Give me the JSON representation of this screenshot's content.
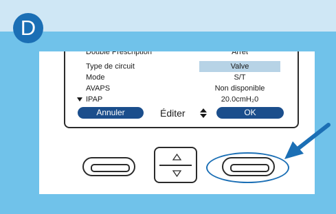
{
  "step": {
    "letter": "D"
  },
  "screen": {
    "partial_row": {
      "label": "Double Prescription",
      "value": "Arrêt"
    },
    "rows": [
      {
        "label": "Type de circuit",
        "value": "Valve",
        "selected": true
      },
      {
        "label": "Mode",
        "value": "S/T"
      },
      {
        "label": "AVAPS",
        "value": "Non disponible"
      },
      {
        "label": "IPAP",
        "value": "20.0cmH₂0"
      }
    ],
    "softkeys": {
      "left": "Annuler",
      "center": "Éditer",
      "right": "OK"
    }
  },
  "hardware": {
    "nav_icons": [
      "up-triangle-icon",
      "down-triangle-icon"
    ],
    "selector_icon": "up-down-arrow-icon",
    "scroll_marker_icon": "down-triangle-icon"
  },
  "colors": {
    "top_bar": "#cfe7f5",
    "frame": "#70c2ea",
    "badge": "#1b6fb5",
    "softkey": "#1b4e8c",
    "selection": "#b7d3e6",
    "highlight": "#1b6fb5"
  }
}
